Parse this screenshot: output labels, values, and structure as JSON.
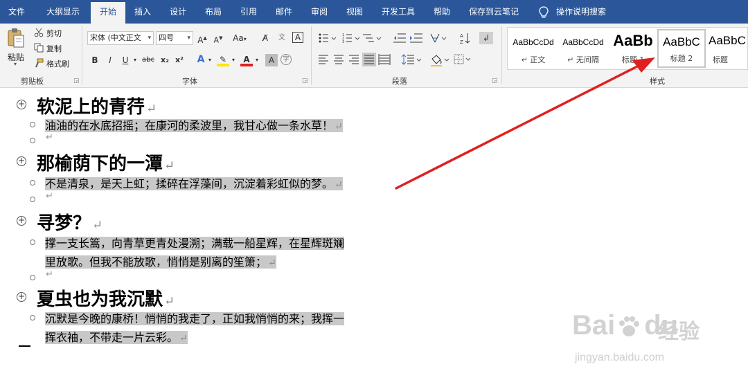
{
  "menu": {
    "tabs": [
      "文件",
      "大纲显示",
      "开始",
      "插入",
      "设计",
      "布局",
      "引用",
      "邮件",
      "审阅",
      "视图",
      "开发工具",
      "帮助",
      "保存到云笔记"
    ],
    "active_tab": "开始",
    "search_label": "操作说明搜索"
  },
  "ribbon": {
    "clipboard": {
      "label": "剪贴板",
      "paste": "粘贴",
      "cut": "剪切",
      "copy": "复制",
      "format_painter": "格式刷"
    },
    "font": {
      "label": "字体",
      "font_name": "宋体 (中文正文",
      "font_size": "四号",
      "change_case": "Aa",
      "bold": "B",
      "italic": "I",
      "underline": "U",
      "strike": "abc",
      "subscript": "x₂",
      "superscript": "x²"
    },
    "paragraph": {
      "label": "段落"
    },
    "styles": {
      "label": "样式",
      "items": [
        {
          "sample": "AaBbCcDd",
          "name": "↵ 正文"
        },
        {
          "sample": "AaBbCcDd",
          "name": "↵ 无间隔"
        },
        {
          "sample": "AaBb",
          "name": "标题 1"
        },
        {
          "sample": "AaBbC",
          "name": "标题 2"
        },
        {
          "sample": "AaBbC",
          "name": "标题"
        }
      ],
      "selected_index": 3
    }
  },
  "document": {
    "return_mark": "↵",
    "sections": [
      {
        "heading": "软泥上的青荇",
        "body": "油油的在水底招摇；在康河的柔波里，我甘心做一条水草！"
      },
      {
        "heading": "那榆荫下的一潭",
        "body": "不是清泉，是天上虹；揉碎在浮藻间，沉淀着彩虹似的梦。"
      },
      {
        "heading": "寻梦？",
        "body_lines": [
          "撑一支长篙，向青草更青处漫溯；满载一船星辉，在星辉斑斓",
          "里放歌。但我不能放歌，悄悄是别离的笙箫；"
        ]
      },
      {
        "heading": "夏虫也为我沉默",
        "body_lines": [
          "沉默是今晚的康桥！悄悄的我走了，正如我悄悄的来；我挥一",
          "挥衣袖，不带走一片云彩。"
        ]
      }
    ]
  },
  "annotation": {
    "arrow_color": "#e02020"
  },
  "watermark": {
    "brand_left": "Bai",
    "brand_right": "du",
    "brand_cn": "经验",
    "url": "jingyan.baidu.com"
  },
  "colors": {
    "menubar": "#2b579a",
    "ribbon": "#f3f3f3",
    "highlight": "#c8c8c8"
  }
}
